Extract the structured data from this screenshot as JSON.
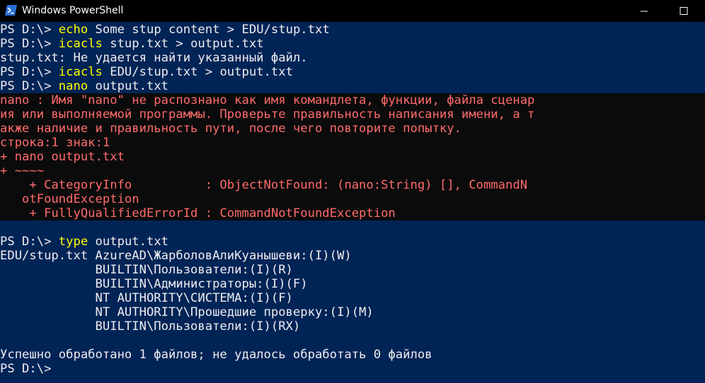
{
  "window": {
    "title": "Windows PowerShell",
    "icon": "powershell-icon"
  },
  "block1": {
    "prompt": "PS D:\\> ",
    "cmd1": {
      "kw": "echo",
      "rest": " Some stup content > EDU/stup.txt"
    },
    "cmd2": {
      "kw": "icacls",
      "rest": " stup.txt > output.txt"
    },
    "err1": "stup.txt: Не удается найти указанный файл.",
    "cmd3": {
      "kw": "icacls",
      "rest": " EDU/stup.txt > output.txt"
    },
    "cmd4": {
      "kw": "nano",
      "rest": " output.txt"
    }
  },
  "error_lines": [
    "nano : Имя \"nano\" не распознано как имя командлета, функции, файла сценар",
    "ия или выполняемой программы. Проверьте правильность написания имени, а т",
    "акже наличие и правильность пути, после чего повторите попытку.",
    "строка:1 знак:1",
    "+ nano output.txt",
    "+ ~~~~",
    "    + CategoryInfo          : ObjectNotFound: (nano:String) [], CommandN",
    "   otFoundException",
    "    + FullyQualifiedErrorId : CommandNotFoundException"
  ],
  "block2": {
    "cmd5": {
      "kw": "type",
      "rest": " output.txt"
    },
    "acl_lines": [
      "EDU/stup.txt AzureAD\\ЖарболовАлиКуанышеви:(I)(W)",
      "             BUILTIN\\Пользователи:(I)(R)",
      "             BUILTIN\\Администраторы:(I)(F)",
      "             NT AUTHORITY\\СИСТЕМА:(I)(F)",
      "             NT AUTHORITY\\Прошедшие проверку:(I)(M)",
      "             BUILTIN\\Пользователи:(I)(RX)"
    ],
    "summary": "Успешно обработано 1 файлов; не удалось обработать 0 файлов",
    "final_prompt": "PS D:\\>"
  },
  "colors": {
    "background": "#012456",
    "error_bg": "#0b0b0b",
    "error_fg": "#ff6b6b",
    "command_fg": "#ffff00",
    "text_fg": "#eeedf0"
  }
}
